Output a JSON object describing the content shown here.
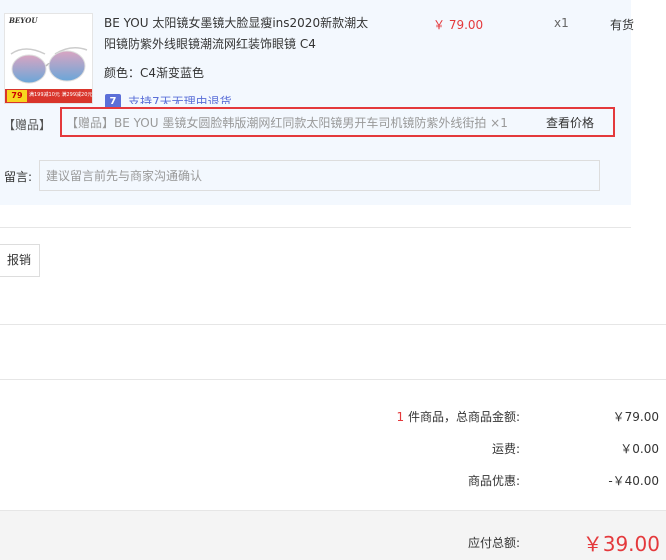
{
  "product": {
    "thumbnail": {
      "brand": "BEYOU",
      "price_badge": "79",
      "promo_text": "满199减10元 满299减20元"
    },
    "title": "BE YOU 太阳镜女墨镜大脸显瘦ins2020新款潮太阳镜防紫外线眼镜潮流网红装饰眼镜 C4",
    "price": "￥ 79.00",
    "quantity": "x1",
    "stock": "有货",
    "color": "颜色：C4渐变蓝色",
    "return_badge": "7",
    "return_text": "支持7天无理由退货"
  },
  "gift": {
    "label": "【赠品】",
    "text": "【赠品】BE YOU 墨镜女圆脸韩版潮网红同款太阳镜男开车司机镜防紫外线街拍 ×1",
    "link": "查看价格"
  },
  "message": {
    "label": "留言:",
    "placeholder": "建议留言前先与商家沟通确认"
  },
  "invoice": {
    "button_label": "报销"
  },
  "summary": {
    "count": "1",
    "goods_label": "件商品，总商品金额:",
    "goods_value": "￥79.00",
    "shipping_label": "运费:",
    "shipping_value": "￥0.00",
    "discount_label": "商品优惠:",
    "discount_value": "-￥40.00",
    "total_label": "应付总额:",
    "total_value": "￥39.00"
  },
  "colors": {
    "accent_red": "#e4393c",
    "link_blue": "#5b6fd8",
    "panel_bg": "#f3f8fe"
  }
}
